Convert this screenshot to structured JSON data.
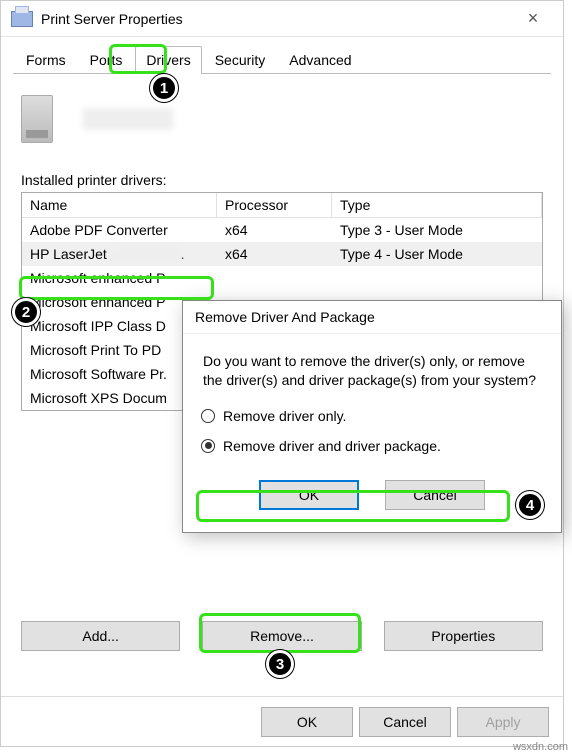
{
  "window": {
    "title": "Print Server Properties",
    "tabs": [
      "Forms",
      "Ports",
      "Drivers",
      "Security",
      "Advanced"
    ],
    "active_tab_index": 2,
    "list_label": "Installed printer drivers:",
    "columns": [
      "Name",
      "Processor",
      "Type"
    ],
    "rows": [
      {
        "name": "Adobe PDF Converter",
        "proc": "x64",
        "type": "Type 3 - User Mode",
        "sel": false
      },
      {
        "name": "HP LaserJet",
        "proc": "x64",
        "type": "Type 4 - User Mode",
        "sel": true,
        "blur_tail": true
      },
      {
        "name": "Microsoft enhanced P",
        "proc": "",
        "type": "",
        "sel": false
      },
      {
        "name": "Microsoft enhanced P",
        "proc": "",
        "type": "",
        "sel": false
      },
      {
        "name": "Microsoft IPP Class D",
        "proc": "",
        "type": "",
        "sel": false
      },
      {
        "name": "Microsoft Print To PD",
        "proc": "",
        "type": "",
        "sel": false
      },
      {
        "name": "Microsoft Software Pr.",
        "proc": "",
        "type": "",
        "sel": false
      },
      {
        "name": "Microsoft XPS Docum",
        "proc": "",
        "type": "",
        "sel": false
      }
    ],
    "bottom_buttons": {
      "add": "Add...",
      "remove": "Remove...",
      "props": "Properties"
    },
    "footer_buttons": {
      "ok": "OK",
      "cancel": "Cancel",
      "apply": "Apply"
    }
  },
  "dialog": {
    "title": "Remove Driver And Package",
    "message": "Do you want to remove the driver(s) only, or remove the driver(s) and driver package(s) from your system?",
    "opt1": "Remove driver only.",
    "opt2": "Remove driver and driver package.",
    "selected": 1,
    "ok": "OK",
    "cancel": "Cancel"
  },
  "annotations": {
    "b1": "1",
    "b2": "2",
    "b3": "3",
    "b4": "4"
  },
  "watermark": "wsxdn.com"
}
